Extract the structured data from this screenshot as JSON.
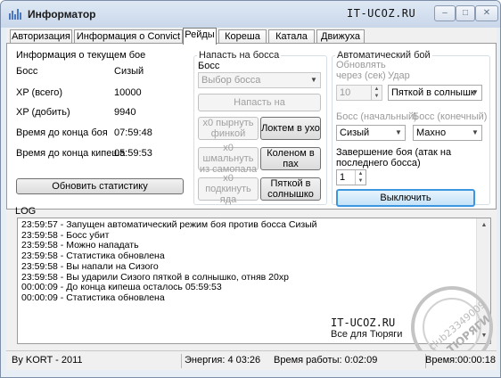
{
  "window": {
    "title": "Информатор",
    "watermark_title": "IT-UCOZ.RU",
    "min_glyph": "–",
    "max_glyph": "□",
    "close_glyph": "✕"
  },
  "tabs": [
    {
      "label": "Авторизация",
      "active": false
    },
    {
      "label": "Информация о Convict",
      "active": false
    },
    {
      "label": "Рейды",
      "active": true
    },
    {
      "label": "Кореша",
      "active": false
    },
    {
      "label": "Катала",
      "active": false
    },
    {
      "label": "Движуха",
      "active": false
    }
  ],
  "battle_info": {
    "title": "Информация о текущем бое",
    "rows": [
      {
        "label": "Босс",
        "value": "Сизый"
      },
      {
        "label": "XP (всего)",
        "value": "10000"
      },
      {
        "label": "XP (добить)",
        "value": "9940"
      },
      {
        "label": "Время до конца боя",
        "value": "07:59:48"
      },
      {
        "label": "Время до конца кипеша",
        "value": "05:59:53"
      }
    ],
    "refresh_button": "Обновить статистику"
  },
  "attack": {
    "title": "Напасть на босса",
    "boss_label": "Босс",
    "boss_select": "Выбор босса",
    "attack_button": "Напасть на",
    "moves": [
      {
        "left": "х0 пырнуть финкой",
        "right": "Локтем в ухо"
      },
      {
        "left": "х0 шмальнуть из самопала",
        "right": "Коленом в пах"
      },
      {
        "left": "х0 подкинуть яда",
        "right": "Пяткой в солнышко"
      }
    ]
  },
  "auto_battle": {
    "title": "Автоматический бой",
    "refresh_label": "Обновлять через (сек)",
    "refresh_value": "10",
    "hit_label": "Удар",
    "hit_value": "Пяткой в солнышк",
    "boss_start_label": "Босс (начальный)",
    "boss_start_value": "Сизый",
    "boss_end_label": "Босс (конечный)",
    "boss_end_value": "Махно",
    "finish_label": "Завершение боя (атак на последнего босса)",
    "finish_value": "1",
    "toggle_button": "Выключить"
  },
  "log": {
    "label": "LOG",
    "lines": [
      "23:59:57 - Запущен автоматический режим боя против босса Сизый",
      "23:59:58 - Босс убит",
      "23:59:58 - Можно нападать",
      "23:59:58 - Статистика обновлена",
      "23:59:58 - Вы напали на Сизого",
      "23:59:58 - Вы ударили Сизого пяткой в солнышко, отняв 20хр",
      "00:00:09 - До конца кипеша осталось 05:59:53",
      "00:00:09 - Статистика обновлена"
    ]
  },
  "watermark": {
    "line1": "IT-UCOZ.RU",
    "line2": "Все для Тюряги",
    "stamp_text": "club23349009",
    "stamp_word": "ТЮРЯГИ"
  },
  "status": {
    "author": "By KORT - 2011",
    "energy": "Энергия: 4  03:26",
    "uptime": "Время работы: 0:02:09",
    "time": "Время:00:00:18"
  }
}
